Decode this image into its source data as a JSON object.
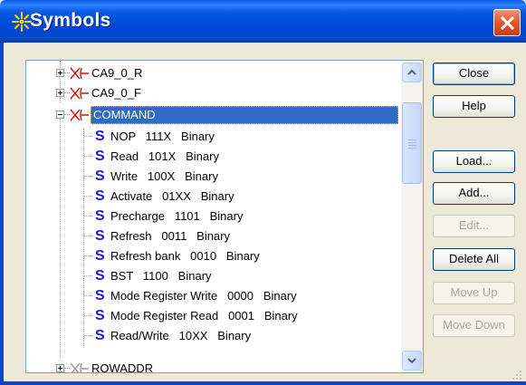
{
  "window": {
    "title": "Symbols",
    "icon": "symbols-app-icon",
    "colors": {
      "titlebar": "#0048d8",
      "close": "#e25b32",
      "selection": "#316ac5",
      "symbol_glyph": "#1a18d8",
      "bus_icon": "#d01010"
    }
  },
  "tree": {
    "nodes": [
      {
        "label": "CA9_0_R",
        "type": "bus",
        "expanded": false
      },
      {
        "label": "CA9_0_F",
        "type": "bus",
        "expanded": false
      },
      {
        "label": "COMMAND",
        "type": "bus",
        "expanded": true,
        "selected": true
      },
      {
        "label": "NOP   111X   Binary",
        "type": "symbol",
        "glyph": "S"
      },
      {
        "label": "Read   101X   Binary",
        "type": "symbol",
        "glyph": "S"
      },
      {
        "label": "Write   100X   Binary",
        "type": "symbol",
        "glyph": "S"
      },
      {
        "label": "Activate   01XX   Binary",
        "type": "symbol",
        "glyph": "S"
      },
      {
        "label": "Precharge   1101   Binary",
        "type": "symbol",
        "glyph": "S"
      },
      {
        "label": "Refresh   0011   Binary",
        "type": "symbol",
        "glyph": "S"
      },
      {
        "label": "Refresh bank   0010   Binary",
        "type": "symbol",
        "glyph": "S"
      },
      {
        "label": "BST   1100   Binary",
        "type": "symbol",
        "glyph": "S"
      },
      {
        "label": "Mode Register Write   0000   Binary",
        "type": "symbol",
        "glyph": "S"
      },
      {
        "label": "Mode Register Read   0001   Binary",
        "type": "symbol",
        "glyph": "S"
      },
      {
        "label": "Read/Write   10XX   Binary",
        "type": "symbol",
        "glyph": "S"
      },
      {
        "label": "ROWADDR",
        "type": "bus",
        "expanded": false
      }
    ]
  },
  "buttons": {
    "close": "Close",
    "help": "Help",
    "load": "Load...",
    "add": "Add...",
    "edit": "Edit...",
    "delete_all": "Delete All",
    "move_up": "Move Up",
    "move_down": "Move Down"
  }
}
